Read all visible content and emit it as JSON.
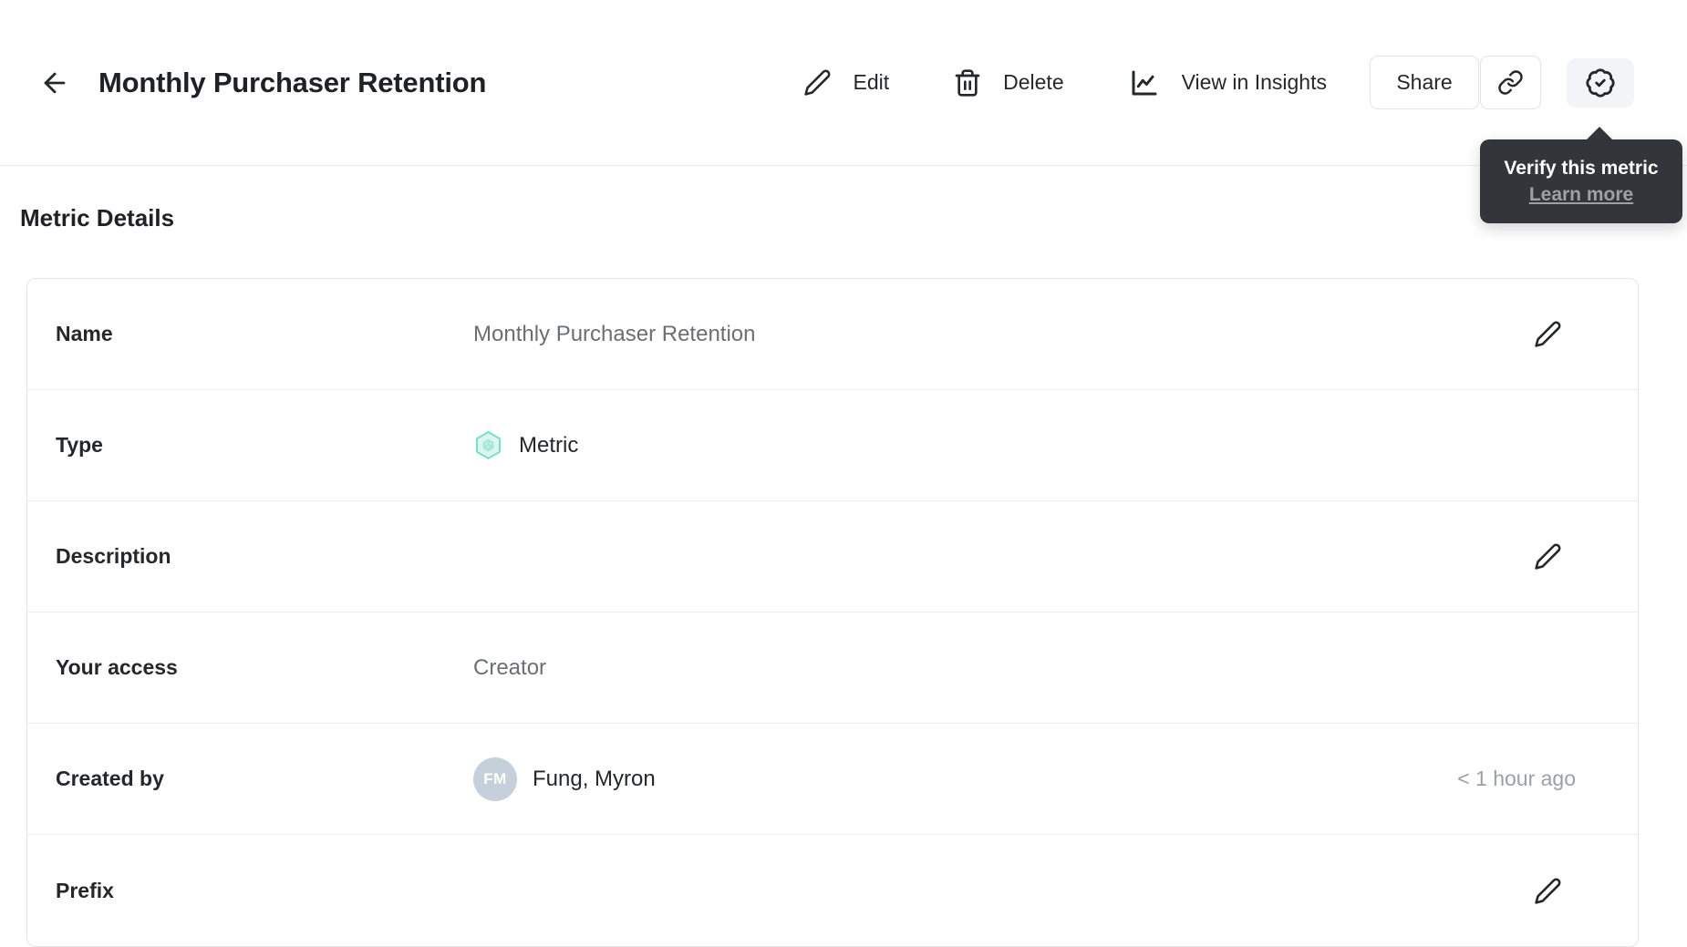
{
  "header": {
    "title": "Monthly Purchaser Retention",
    "actions": {
      "edit": "Edit",
      "delete": "Delete",
      "view_in_insights": "View in Insights",
      "share": "Share"
    }
  },
  "verify_tooltip": {
    "title": "Verify this metric",
    "link_label": "Learn more"
  },
  "section_heading": "Metric Details",
  "rows": {
    "name": {
      "label": "Name",
      "value": "Monthly Purchaser Retention"
    },
    "type": {
      "label": "Type",
      "value": "Metric"
    },
    "description": {
      "label": "Description",
      "value": ""
    },
    "access": {
      "label": "Your access",
      "value": "Creator"
    },
    "created_by": {
      "label": "Created by",
      "value": "Fung, Myron",
      "avatar_initials": "FM",
      "timestamp": "< 1 hour ago"
    },
    "prefix": {
      "label": "Prefix",
      "value": ""
    }
  },
  "icons": {
    "back": "arrow-left-icon",
    "edit": "pencil-icon",
    "delete": "trash-icon",
    "view_in_insights": "line-chart-icon",
    "copy_link": "link-icon",
    "verify": "badge-check-icon",
    "metric_type": "hexagon-metric-icon"
  },
  "colors": {
    "accent_teal": "#7be0cb",
    "accent_teal_fill": "#ddf5ee",
    "accent_teal_inner": "#a6e9d8",
    "tooltip_bg": "#323539",
    "avatar_bg": "#c6d0db",
    "text_dark": "#25272c",
    "text_gray": "#6b6f75",
    "text_light_gray": "#9aa0a7",
    "border": "#e3e5e8"
  }
}
